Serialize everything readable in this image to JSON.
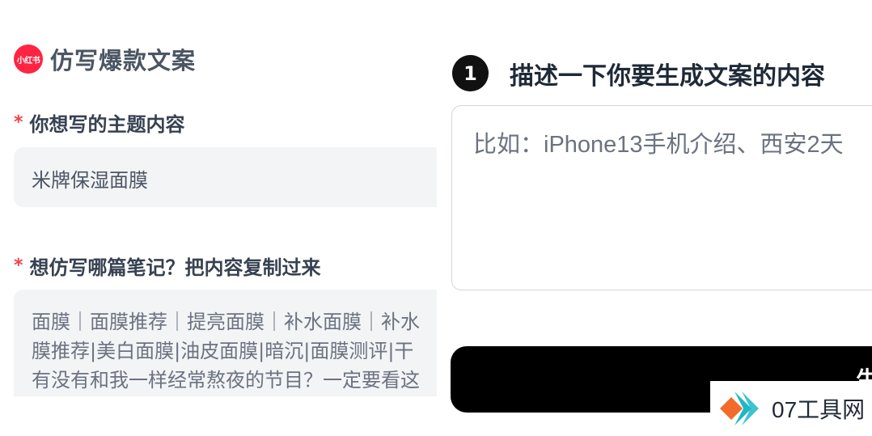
{
  "app": {
    "logo_text": "小红书",
    "title": "仿写爆款文案"
  },
  "form": {
    "topic_label": "你想写的主题内容",
    "topic_value": "米牌保湿面膜",
    "imitate_label": "想仿写哪篇笔记？把内容复制过来",
    "imitate_lines": [
      "面膜｜面膜推荐｜提亮面膜｜补水面膜｜补水",
      "膜推荐|美白面膜|油皮面膜|暗沉|面膜测评|干",
      "有没有和我一样经常熬夜的节目？一定要看这"
    ],
    "required_mark": "*"
  },
  "generator": {
    "step_number": "1",
    "step_title": "描述一下你要生成文案的内容",
    "placeholder": "比如：iPhone13手机介绍、西安2天",
    "button_label": "生"
  },
  "watermark": {
    "text": "07工具网",
    "colors": {
      "orange": "#f26b2a",
      "teal": "#1fb7c7"
    }
  },
  "colors": {
    "brand_red": "#ff2442",
    "required_red": "#ef4444",
    "button_black": "#000000"
  }
}
